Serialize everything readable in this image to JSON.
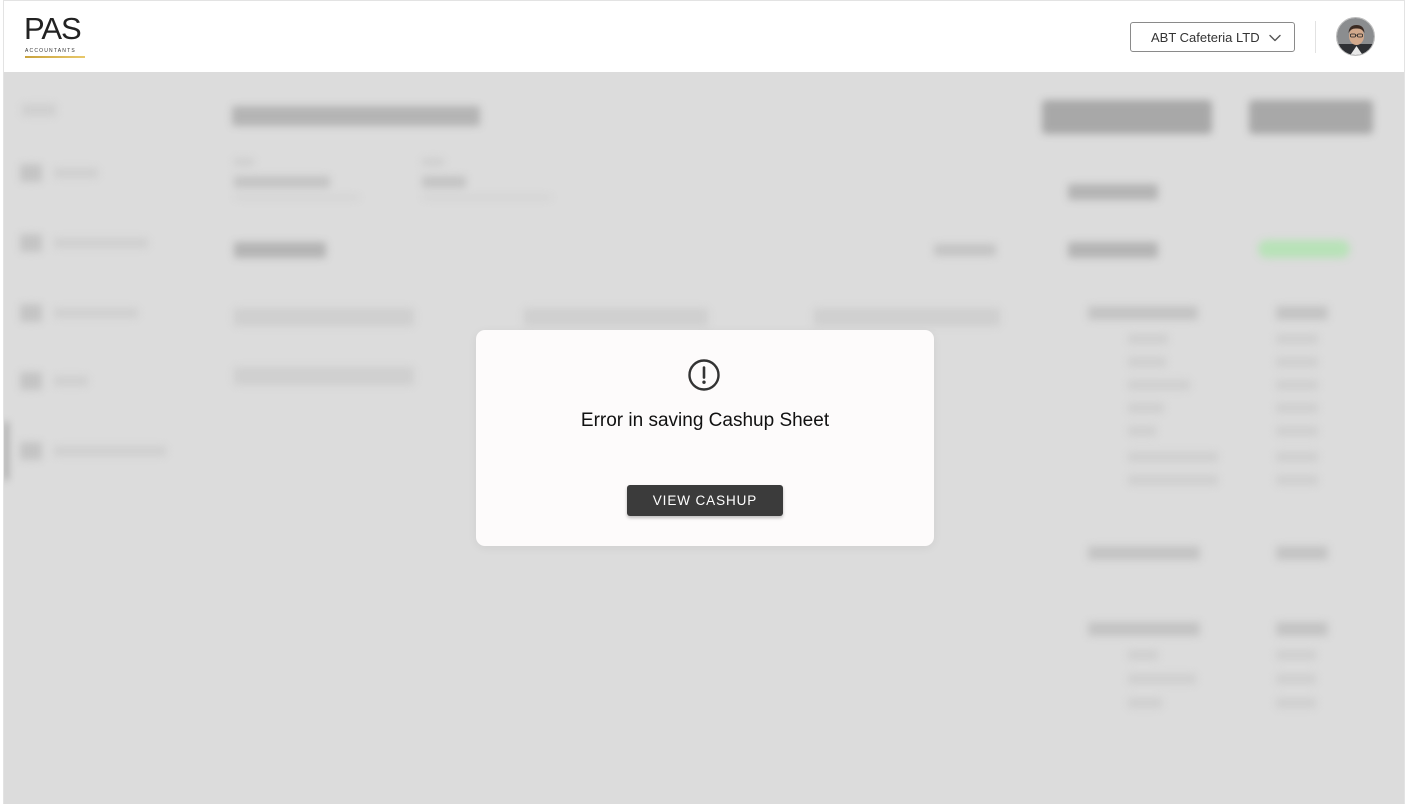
{
  "header": {
    "logo": {
      "main": "PAS",
      "sub": "ACCOUNTANTS"
    },
    "company_selector": {
      "selected": "ABT Cafeteria LTD",
      "icon": "chevron-down-icon"
    },
    "avatar": {
      "icon": "user-avatar"
    }
  },
  "dialog": {
    "icon": "exclamation-circle-icon",
    "message": "Error in saving Cashup Sheet",
    "button_label": "VIEW CASHUP"
  },
  "colors": {
    "overlay": "#dcdcdc",
    "dialog_bg": "#fdfbfb",
    "button_bg": "#3b3b3b",
    "logo_accent": "#c9a23c"
  }
}
